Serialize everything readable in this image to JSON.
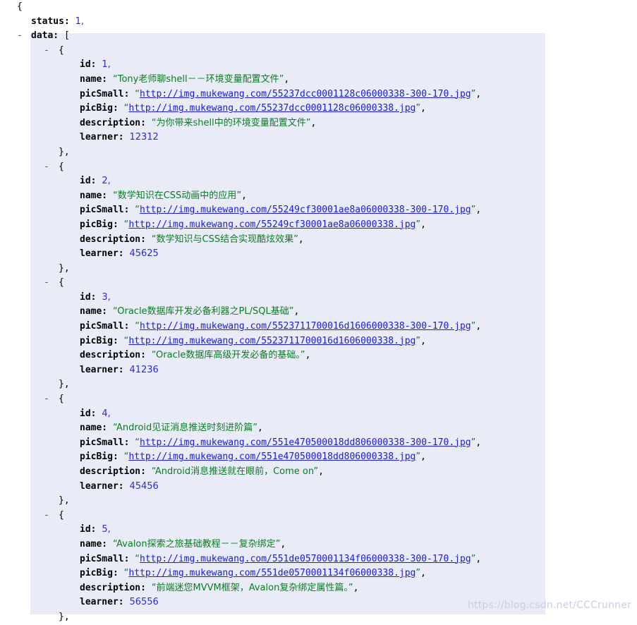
{
  "viewer": {
    "type": "json-tree-viewer",
    "collapse_marker": "-",
    "open_brace": "{",
    "close_brace": "}",
    "close_brace_comma": "},",
    "open_bracket": "[",
    "colors": {
      "highlight_background": "#e9ebf7",
      "key": "#000000",
      "string": "#0a7d22",
      "number": "#2b2bd4",
      "link": "#1a1ae0",
      "page_background": "#ffffff"
    }
  },
  "watermark": "https://blog.csdn.net/CCCrunner",
  "root": {
    "status_key": "status:",
    "status_value": "1,",
    "data_key": "data:"
  },
  "keys": {
    "id": "id:",
    "name": "name:",
    "picSmall": "picSmall:",
    "picBig": "picBig:",
    "description": "description:",
    "learner": "learner:"
  },
  "json_data": {
    "status": 1,
    "data": [
      {
        "id": "1,",
        "name": "Tony老师聊shell－－环境变量配置文件",
        "picSmall": "http://img.mukewang.com/55237dcc0001128c06000338-300-170.jpg",
        "picBig": "http://img.mukewang.com/55237dcc0001128c06000338.jpg",
        "description": "为你带来shell中的环境变量配置文件",
        "learner": "12312"
      },
      {
        "id": "2,",
        "name": "数学知识在CSS动画中的应用",
        "picSmall": "http://img.mukewang.com/55249cf30001ae8a06000338-300-170.jpg",
        "picBig": "http://img.mukewang.com/55249cf30001ae8a06000338.jpg",
        "description": "数学知识与CSS结合实现酷炫效果",
        "learner": "45625"
      },
      {
        "id": "3,",
        "name": "Oracle数据库开发必备利器之PL/SQL基础",
        "picSmall": "http://img.mukewang.com/5523711700016d1606000338-300-170.jpg",
        "picBig": "http://img.mukewang.com/5523711700016d1606000338.jpg",
        "description": "Oracle数据库高级开发必备的基础。",
        "learner": "41236"
      },
      {
        "id": "4,",
        "name": "Android见证消息推送时刻进阶篇",
        "picSmall": "http://img.mukewang.com/551e470500018dd806000338-300-170.jpg",
        "picBig": "http://img.mukewang.com/551e470500018dd806000338.jpg",
        "description": "Android消息推送就在眼前，Come on",
        "learner": "45456"
      },
      {
        "id": "5,",
        "name": "Avalon探索之旅基础教程－－复杂绑定",
        "picSmall": "http://img.mukewang.com/551de0570001134f06000338-300-170.jpg",
        "picBig": "http://img.mukewang.com/551de0570001134f06000338.jpg",
        "description": "前端迷您MVVM框架，Avalon复杂绑定属性篇。",
        "learner": "56556"
      }
    ]
  }
}
